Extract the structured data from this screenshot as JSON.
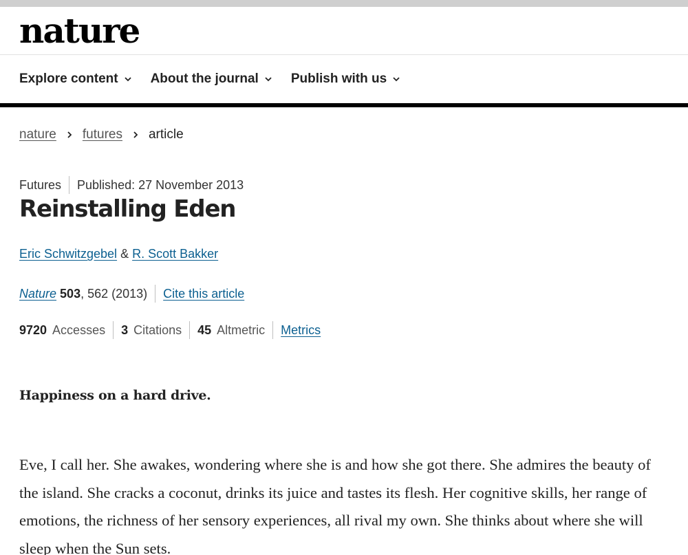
{
  "site": {
    "logo": "nature"
  },
  "nav": {
    "items": [
      {
        "label": "Explore content"
      },
      {
        "label": "About the journal"
      },
      {
        "label": "Publish with us"
      }
    ]
  },
  "breadcrumb": {
    "items": [
      "nature",
      "futures",
      "article"
    ]
  },
  "article": {
    "type": "Futures",
    "published": "Published: 27 November 2013",
    "title": "Reinstalling Eden",
    "author1": "Eric Schwitzgebel",
    "author_sep": "&",
    "author2": "R. Scott Bakker",
    "journal": "Nature",
    "volume": "503",
    "pages_year": ", 562 (2013)",
    "cite_label": "Cite this article",
    "metrics": {
      "accesses_value": "9720",
      "accesses_label": "Accesses",
      "citations_value": "3",
      "citations_label": "Citations",
      "altmetric_value": "45",
      "altmetric_label": "Altmetric",
      "metrics_link": "Metrics"
    },
    "standfirst": "Happiness on a hard drive.",
    "body": "Eve, I call her. She awakes, wondering where she is and how she got there. She admires the beauty of the island. She cracks a coconut, drinks its juice and tastes its flesh. Her cognitive skills, her range of emotions, the richness of her sensory experiences, all rival my own. She thinks about where she will sleep when the Sun sets."
  },
  "icons": {
    "nav_chevron": "chevron-down-icon",
    "breadcrumb_separator": "chevron-right-icon"
  },
  "colors": {
    "link": "#0b5f90",
    "rule": "#000000",
    "text": "#222222"
  }
}
